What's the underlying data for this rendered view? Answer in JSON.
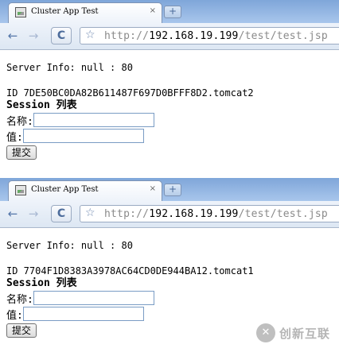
{
  "windows": [
    {
      "tab": {
        "title": "Cluster App Test",
        "close": "×"
      },
      "newtab": "+",
      "toolbar": {
        "back": "←",
        "forward": "→",
        "reload": "C",
        "star": "☆",
        "url_scheme": "http://",
        "url_host": "192.168.19.199",
        "url_path": "/test/test.jsp"
      },
      "page": {
        "server_info": "Server Info: null : 80",
        "session_id": "ID 7DE50BC0DA82B611487F697D0BFFF8D2.tomcat2",
        "session_heading": "Session 列表",
        "name_label": "名称:",
        "name_value": "",
        "value_label": "值:",
        "value_value": "",
        "submit_label": "提交"
      }
    },
    {
      "tab": {
        "title": "Cluster App Test",
        "close": "×"
      },
      "newtab": "+",
      "toolbar": {
        "back": "←",
        "forward": "→",
        "reload": "C",
        "star": "☆",
        "url_scheme": "http://",
        "url_host": "192.168.19.199",
        "url_path": "/test/test.jsp"
      },
      "page": {
        "server_info": "Server Info: null : 80",
        "session_id": "ID 7704F1D8383A3978AC64CD0DE944BA12.tomcat1",
        "session_heading": "Session 列表",
        "name_label": "名称:",
        "name_value": "",
        "value_label": "值:",
        "value_value": "",
        "submit_label": "提交"
      }
    }
  ],
  "watermark": {
    "logo": "✕",
    "text": "创新互联"
  }
}
